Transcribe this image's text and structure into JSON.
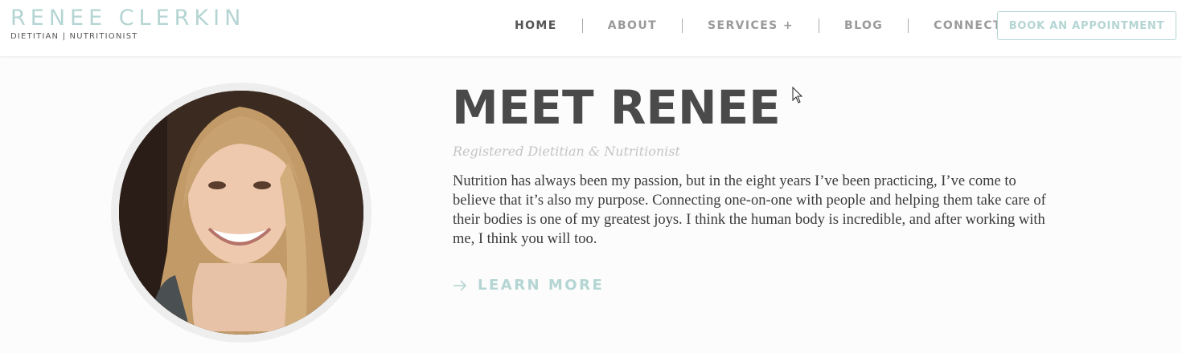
{
  "brand": {
    "name": "RENEE CLERKIN",
    "tagline": "DIETITIAN | NUTRITIONIST"
  },
  "nav": {
    "items": [
      {
        "label": "HOME",
        "active": true
      },
      {
        "label": "ABOUT",
        "active": false
      },
      {
        "label": "SERVICES +",
        "active": false
      },
      {
        "label": "BLOG",
        "active": false
      },
      {
        "label": "CONNECT",
        "active": false
      }
    ],
    "cta_label": "BOOK AN APPOINTMENT"
  },
  "hero": {
    "title": "MEET RENEE",
    "subtitle": "Registered Dietitian & Nutritionist",
    "bio": "Nutrition has always been my passion, but in the eight years I’ve been practicing, I’ve come to believe that it’s also my purpose. Connecting one-on-one with people and helping them take care of their bodies is one of my greatest joys. I think the human body is incredible, and after working with me, I think you will too.",
    "learn_more_label": "LEARN MORE"
  },
  "colors": {
    "accent": "#b4d5d3",
    "heading": "#4a4a4a",
    "nav_inactive": "#9a9a9a",
    "nav_active": "#555555"
  },
  "icons": {
    "learn_more": "arrow-right-icon",
    "cursor": "mouse-pointer-icon"
  }
}
